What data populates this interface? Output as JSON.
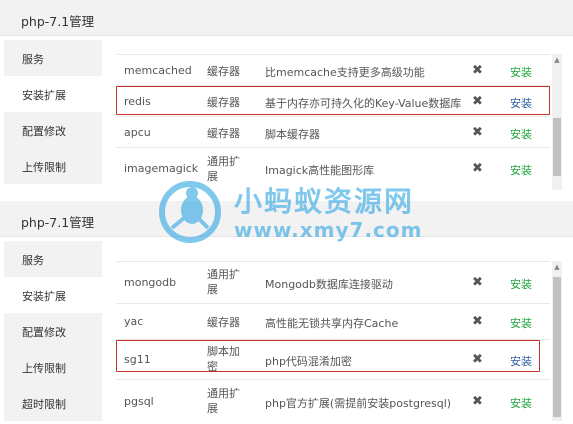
{
  "panel1": {
    "title": "php-7.1管理",
    "sidebar": [
      "服务",
      "安装扩展",
      "配置修改",
      "上传限制"
    ],
    "rows": [
      {
        "name": "memcached",
        "type": "缓存器",
        "desc": "比memcache支持更多高级功能",
        "action": "安装"
      },
      {
        "name": "redis",
        "type": "缓存器",
        "desc": "基于内存亦可持久化的Key-Value数据库",
        "action": "安装"
      },
      {
        "name": "apcu",
        "type": "缓存器",
        "desc": "脚本缓存器",
        "action": "安装"
      },
      {
        "name": "imagemagick",
        "type": "通用扩展",
        "desc": "Imagick高性能图形库",
        "action": "安装"
      }
    ]
  },
  "panel2": {
    "title": "php-7.1管理",
    "sidebar": [
      "服务",
      "安装扩展",
      "配置修改",
      "上传限制",
      "超时限制"
    ],
    "rows": [
      {
        "name": "mongodb",
        "type": "通用扩展",
        "desc": "Mongodb数据库连接驱动",
        "action": "安装"
      },
      {
        "name": "yac",
        "type": "缓存器",
        "desc": "高性能无锁共享内存Cache",
        "action": "安装"
      },
      {
        "name": "sg11",
        "type": "脚本加密",
        "desc": "php代码混淆加密",
        "action": "安装"
      },
      {
        "name": "pgsql",
        "type": "通用扩展",
        "desc": "php官方扩展(需提前安装postgresql)",
        "action": "安装"
      }
    ]
  },
  "remove_glyph": "✖",
  "watermark": {
    "cn": "小蚂蚁资源网",
    "url": "www.xmy7.com"
  },
  "colors": {
    "install_green": "#20a53a",
    "highlight_red": "#c9302c",
    "watermark_blue": "#1a9de0"
  }
}
